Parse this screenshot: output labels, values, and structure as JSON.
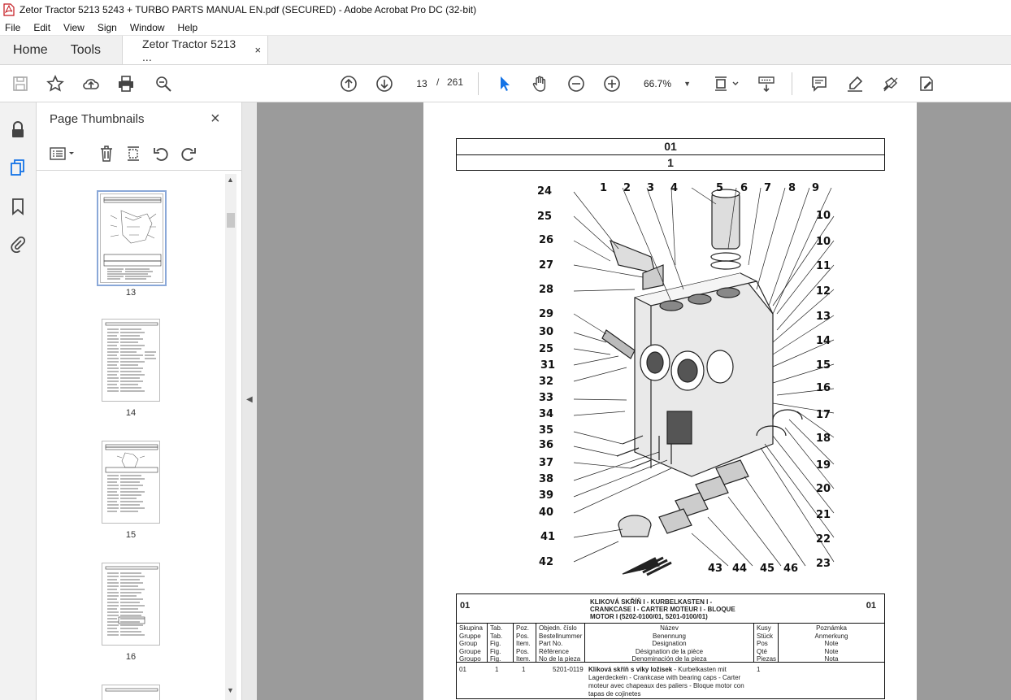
{
  "window": {
    "title": "Zetor Tractor 5213 5243 + TURBO PARTS MANUAL EN.pdf (SECURED) - Adobe Acrobat Pro DC (32-bit)"
  },
  "menu": [
    "File",
    "Edit",
    "View",
    "Sign",
    "Window",
    "Help"
  ],
  "tabs": {
    "home": "Home",
    "tools": "Tools",
    "doc": "Zetor Tractor 5213 ...",
    "close": "×"
  },
  "toolbar": {
    "page_current": "13",
    "page_sep": "/",
    "page_total": "261",
    "zoom": "66.7%"
  },
  "thumbnails": {
    "header": "Page Thumbnails",
    "close": "×",
    "pages": [
      {
        "label": "13",
        "selected": true
      },
      {
        "label": "14",
        "selected": false
      },
      {
        "label": "15",
        "selected": false
      },
      {
        "label": "16",
        "selected": false
      }
    ]
  },
  "document": {
    "header_row1": "01",
    "header_row2": "1",
    "callouts_left": [
      "24",
      "25",
      "26",
      "27",
      "28",
      "29",
      "30",
      "25",
      "31",
      "32",
      "33",
      "34",
      "35",
      "36",
      "37",
      "38",
      "39",
      "40",
      "41",
      "42"
    ],
    "callouts_top": [
      "1",
      "2",
      "3",
      "4",
      "5",
      "6",
      "7",
      "8",
      "9"
    ],
    "callouts_right": [
      "10",
      "10",
      "11",
      "12",
      "13",
      "14",
      "15",
      "16",
      "17",
      "18",
      "19",
      "20",
      "21",
      "22",
      "23"
    ],
    "callouts_bottom": [
      "43",
      "44",
      "45",
      "46"
    ],
    "parts": {
      "group_left": "01",
      "group_right": "01",
      "title_line1": "KLIKOVÁ SKŘÍŇ I - KURBELKASTEN I -",
      "title_line2": "CRANKCASE I - CARTER MOTEUR I - BLOQUE",
      "title_line3": "MOTOR I (5202-0100/01, 5201-0100/01)",
      "col_group": [
        "Skupina",
        "Gruppe",
        "Group",
        "Groupe",
        "Groupo"
      ],
      "col_fig": [
        "Tab.",
        "Tab.",
        "Fig.",
        "Fig.",
        "Fig."
      ],
      "col_pos": [
        "Poz.",
        "Pos.",
        "Item.",
        "Pos.",
        "Item."
      ],
      "col_partno": [
        "Objedn. číslo",
        "Bestellnummer",
        "Part No.",
        "Référence",
        "No de la pieza"
      ],
      "col_name": [
        "Název",
        "Benennung",
        "Designation",
        "Désignation de la pièce",
        "Denominación de la pieza"
      ],
      "col_qty": [
        "Kusy",
        "Stück",
        "Pos",
        "Qté",
        "Piezas"
      ],
      "col_note": [
        "Poznámka",
        "Anmerkung",
        "Note",
        "Note",
        "Nota"
      ],
      "row1": {
        "group": "01",
        "fig": "1",
        "pos": "1",
        "partno": "5201-0119",
        "name_bold": "Kliková skříň s víky ložisek",
        "name_rest": " - Kurbelkasten mit Lagerdeckeln - Crankcase with bearing caps - Carter moteur avec chapeaux des paliers - Bloque motor con tapas de cojinetes",
        "qty": "1"
      }
    }
  }
}
